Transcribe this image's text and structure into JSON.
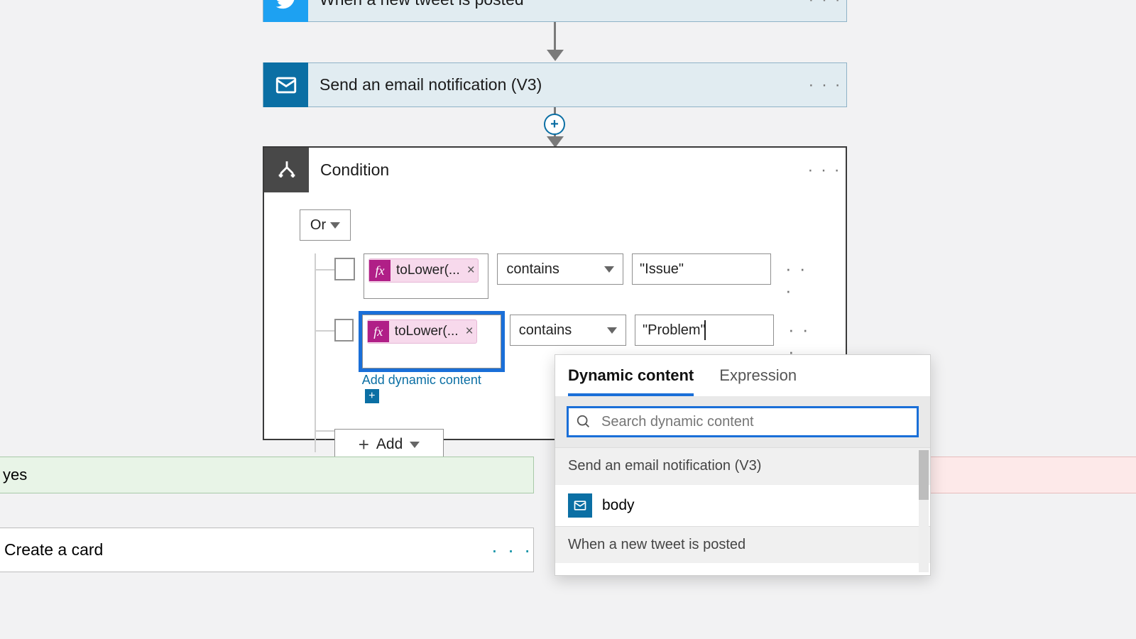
{
  "flow": {
    "trigger_title": "When a new tweet is posted",
    "email_title": "Send an email notification (V3)"
  },
  "condition": {
    "title": "Condition",
    "group_operator": "Or",
    "rows": [
      {
        "expression": "toLower(...",
        "operator": "contains",
        "value": "\"Issue\""
      },
      {
        "expression": "toLower(...",
        "operator": "contains",
        "value": "\"Problem\""
      }
    ],
    "add_dynamic_label": "Add dynamic content",
    "add_button": "Add"
  },
  "branches": {
    "yes_label": "yes",
    "action_title": "Create a card"
  },
  "dynamic_panel": {
    "tab_dynamic": "Dynamic content",
    "tab_expression": "Expression",
    "search_placeholder": "Search dynamic content",
    "section1": "Send an email notification (V3)",
    "item1": "body",
    "section2": "When a new tweet is posted"
  },
  "misc": {
    "ellipsis": "· · ·"
  }
}
